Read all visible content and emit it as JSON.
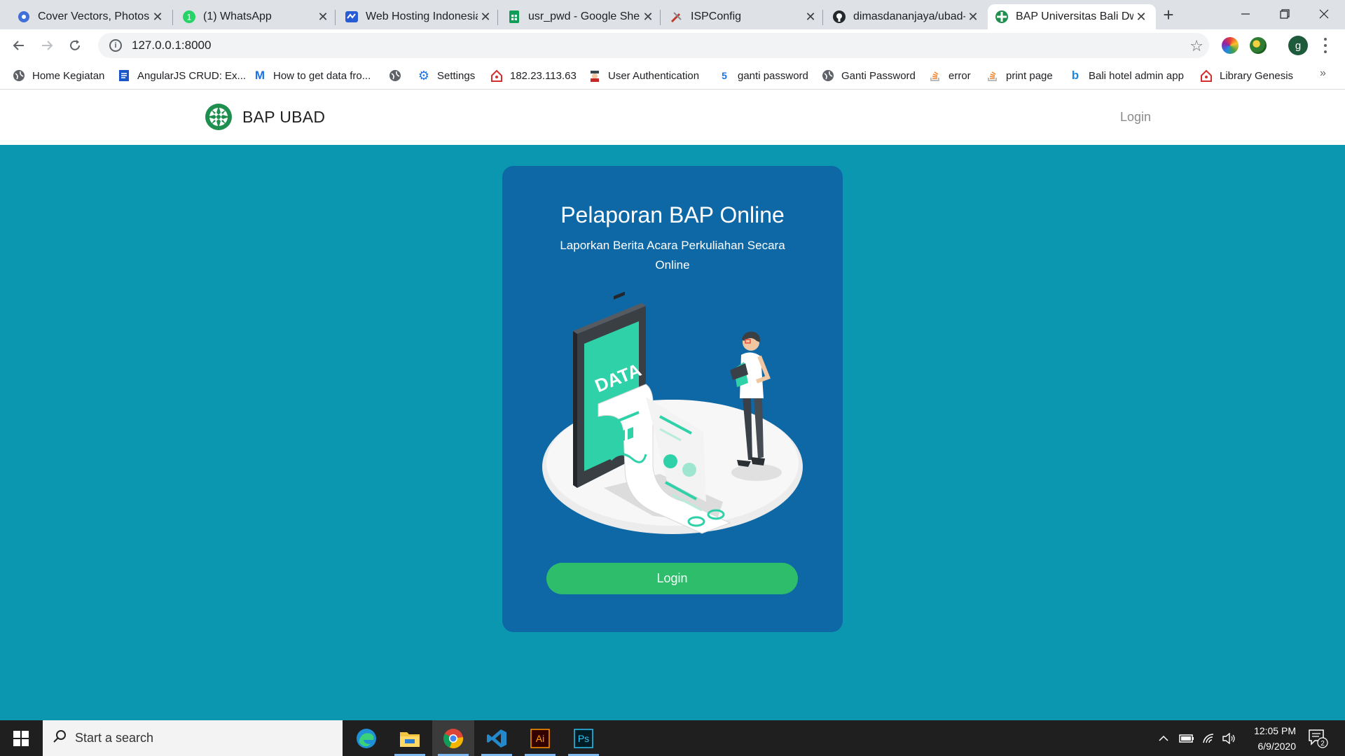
{
  "browser": {
    "tabs": [
      {
        "label": "Cover Vectors, Photos a",
        "icon": "vector-site-icon",
        "active": false
      },
      {
        "label": "(1) WhatsApp",
        "icon": "whatsapp-icon",
        "active": false
      },
      {
        "label": "Web Hosting Indonesia",
        "icon": "hosting-icon",
        "active": false
      },
      {
        "label": "usr_pwd - Google Shee",
        "icon": "google-sheets-icon",
        "active": false
      },
      {
        "label": "ISPConfig",
        "icon": "ispconfig-icon",
        "active": false
      },
      {
        "label": "dimasdananjaya/ubad-",
        "icon": "github-icon",
        "active": false
      },
      {
        "label": "BAP Universitas Bali Dw",
        "icon": "bap-logo-icon",
        "active": true
      }
    ],
    "url": "127.0.0.1:8000",
    "profile_initial": "g",
    "bookmarks": [
      {
        "label": "Home Kegiatan",
        "icon": "globe-icon"
      },
      {
        "label": "AngularJS CRUD: Ex...",
        "icon": "document-icon"
      },
      {
        "label": "How to get data fro...",
        "icon": "medium-icon"
      },
      {
        "label": "",
        "icon": "globe-icon"
      },
      {
        "label": "Settings",
        "icon": "gear-icon"
      },
      {
        "label": "182.23.113.63",
        "icon": "home-red-icon"
      },
      {
        "label": "User Authentication",
        "icon": "spy-icon"
      },
      {
        "label": "ganti password",
        "icon": "number-five-icon"
      },
      {
        "label": "Ganti Password",
        "icon": "globe-icon"
      },
      {
        "label": "error",
        "icon": "stackoverflow-icon"
      },
      {
        "label": "print page",
        "icon": "stackoverflow-icon"
      },
      {
        "label": "Bali hotel admin app",
        "icon": "bing-icon"
      },
      {
        "label": "Library Genesis",
        "icon": "home-red-icon"
      }
    ]
  },
  "page": {
    "brand": "BAP UBAD",
    "nav_login": "Login",
    "card": {
      "title": "Pelaporan BAP Online",
      "subtitle": "Laporkan Berita Acara Perkuliahan Secara Online",
      "illustration_text": "DATA",
      "button": "Login"
    }
  },
  "taskbar": {
    "search_placeholder": "Start a search",
    "apps": [
      "edge-icon",
      "file-explorer-icon",
      "chrome-icon",
      "vscode-icon",
      "illustrator-icon",
      "photoshop-icon"
    ],
    "illustrator_label": "Ai",
    "photoshop_label": "Ps",
    "time": "12:05 PM",
    "date": "6/9/2020",
    "notification_count": "2"
  },
  "colors": {
    "page_background": "#0c97b1",
    "card_background": "#0f68a6",
    "button_green": "#2ebd6a",
    "illustration_teal": "#2fd2a8"
  }
}
